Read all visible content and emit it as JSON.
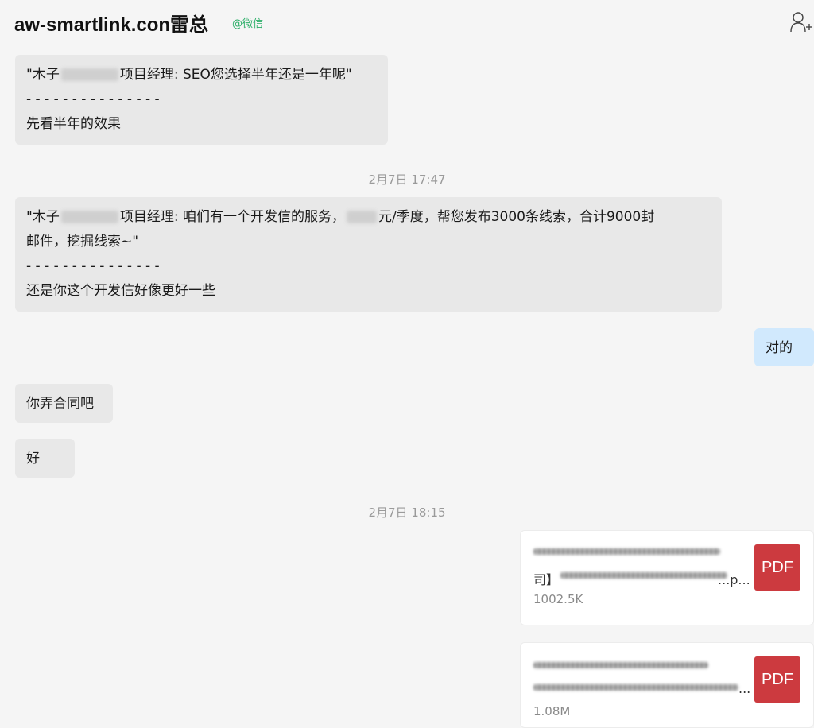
{
  "header": {
    "title": "aw-smartlink.con雷总",
    "tag": "@微信"
  },
  "messages": {
    "m1": {
      "quote_prefix": "\"木子",
      "quote_suffix": "项目经理: SEO您选择半年还是一年呢\"",
      "divider": "- - - - - - - - - - - - - - -",
      "reply": "先看半年的效果"
    },
    "time1": "2月7日 17:47",
    "m2": {
      "quote_prefix": "\"木子",
      "quote_mid": "项目经理: 咱们有一个开发信的服务，",
      "quote_suffix": "元/季度，帮您发布3000条线索，合计9000封",
      "quote_line2": "邮件，挖掘线索~\"",
      "divider": "- - - - - - - - - - - - - - -",
      "reply": "还是你这个开发信好像更好一些"
    },
    "m3": "对的",
    "m4": "你弄合同吧",
    "m5": "好",
    "time2": "2月7日 18:15",
    "file1": {
      "name_visible": "司】",
      "name_tail": "...p...",
      "size": "1002.5K",
      "type": "PDF"
    },
    "file2": {
      "name_tail": "...",
      "size": "1.08M",
      "type": "PDF"
    }
  },
  "colors": {
    "incoming_bubble": "#e8e8e8",
    "outgoing_bubble": "#d1e9fd",
    "tag": "#2aae67",
    "pdf": "#cc3a3f"
  }
}
